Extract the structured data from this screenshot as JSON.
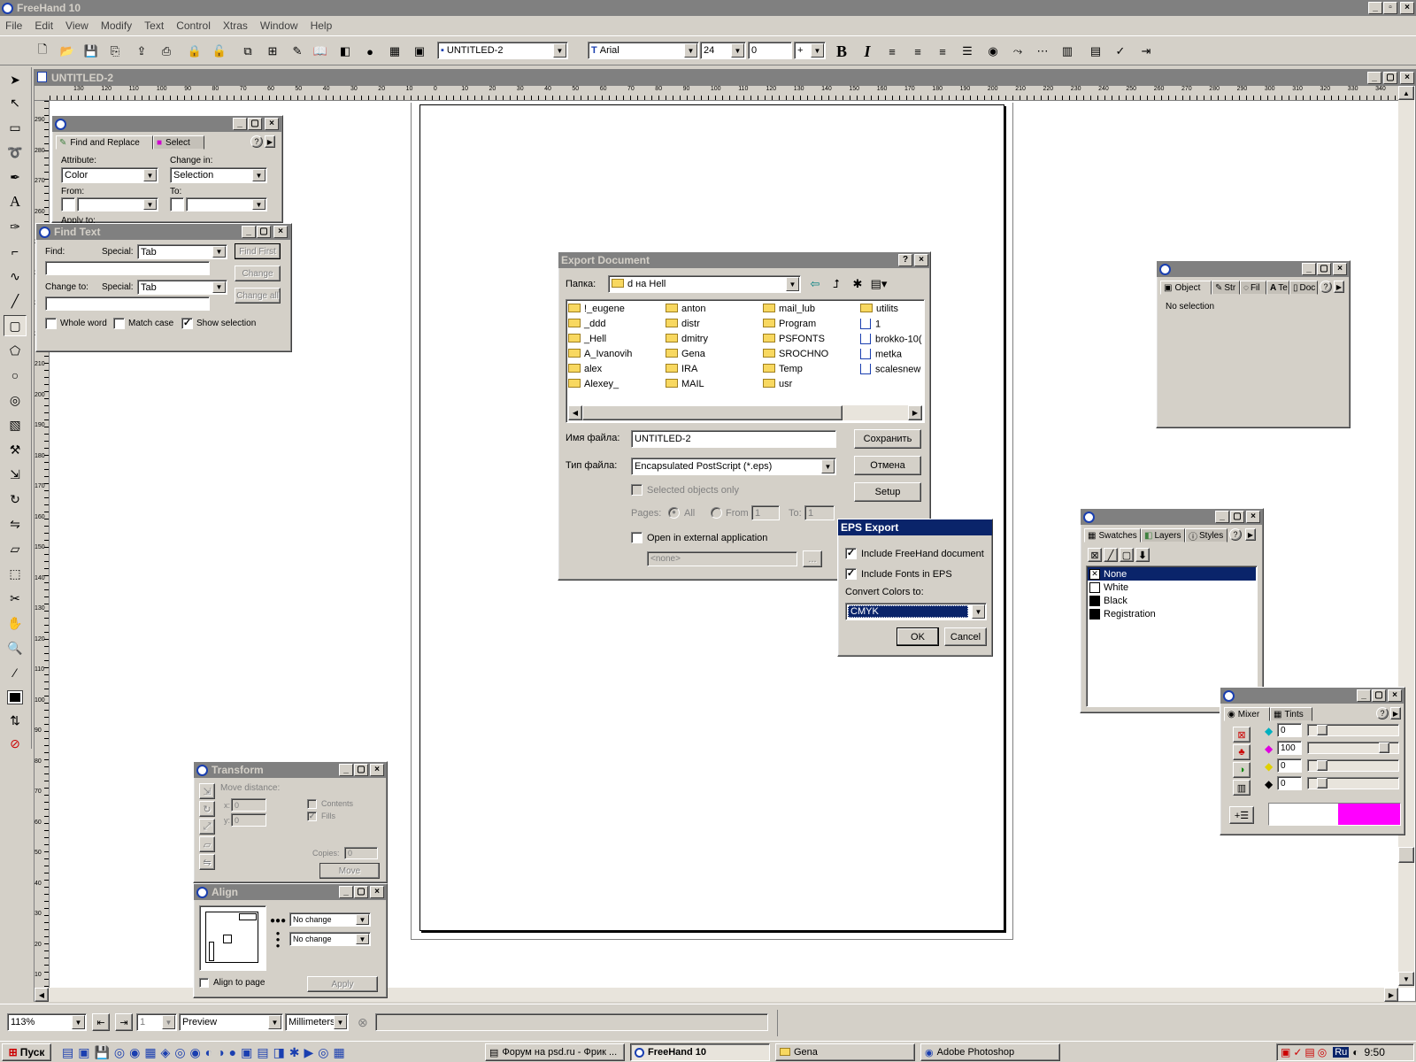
{
  "app": {
    "title": "FreeHand 10"
  },
  "menu": [
    "File",
    "Edit",
    "View",
    "Modify",
    "Text",
    "Control",
    "Xtras",
    "Window",
    "Help"
  ],
  "toolbar": {
    "doc_select": "UNTITLED-2",
    "font_select": "Arial",
    "size_select": "24",
    "leading_value": "0",
    "leading_mode": "+",
    "bold_label": "B",
    "italic_label": "I"
  },
  "document": {
    "title": "UNTITLED-2"
  },
  "ruler_h": [
    "130",
    "120",
    "110",
    "100",
    "90",
    "80",
    "70",
    "60",
    "50",
    "40",
    "30",
    "20",
    "10",
    "0",
    "10",
    "20",
    "30",
    "40",
    "50",
    "60",
    "70",
    "80",
    "90",
    "100",
    "110",
    "120",
    "130",
    "140",
    "150",
    "160",
    "170",
    "180",
    "190",
    "200",
    "210",
    "220",
    "230",
    "240",
    "250",
    "260",
    "270",
    "280",
    "290",
    "300",
    "310",
    "320",
    "330",
    "340"
  ],
  "ruler_v": [
    "290",
    "280",
    "270",
    "260",
    "250",
    "240",
    "230",
    "220",
    "210",
    "200",
    "190",
    "180",
    "170",
    "160",
    "150",
    "140",
    "130",
    "120",
    "110",
    "100",
    "90",
    "80",
    "70",
    "60",
    "50",
    "40",
    "30",
    "20",
    "10"
  ],
  "find_replace": {
    "tab1": "Find and Replace",
    "tab2": "Select",
    "attribute_label": "Attribute:",
    "attribute_value": "Color",
    "change_in_label": "Change in:",
    "change_in_value": "Selection",
    "from_label": "From:",
    "to_label": "To:",
    "apply_label": "Apply to:"
  },
  "find_text": {
    "title": "Find Text",
    "find_label": "Find:",
    "special_label": "Special:",
    "special_value": "Tab",
    "change_to_label": "Change to:",
    "special2_value": "Tab",
    "find_first": "Find First",
    "change": "Change",
    "change_all": "Change all",
    "whole_word": "Whole word",
    "match_case": "Match case",
    "show_selection": "Show selection"
  },
  "export_dialog": {
    "title": "Export Document",
    "folder_label": "Папка:",
    "folder_value": "d на Hell",
    "files": [
      [
        "!_eugene",
        "anton",
        "mail_lub",
        "utilits"
      ],
      [
        "_ddd",
        "distr",
        "Program",
        "1"
      ],
      [
        "_Hell",
        "dmitry",
        "PSFONTS",
        "brokko-10("
      ],
      [
        "A_Ivanovih",
        "Gena",
        "SROCHNO",
        "metka"
      ],
      [
        "alex",
        "IRA",
        "Temp",
        "scalesnew"
      ],
      [
        "Alexey_",
        "MAIL",
        "usr",
        ""
      ]
    ],
    "filename_label": "Имя файла:",
    "filename_value": "UNTITLED-2",
    "filetype_label": "Тип файла:",
    "filetype_value": "Encapsulated PostScript (*.eps)",
    "save_button": "Сохранить",
    "cancel_button": "Отмена",
    "setup_button": "Setup",
    "selected_only": "Selected objects only",
    "pages_label": "Pages:",
    "all_label": "All",
    "from_label": "From",
    "from_value": "1",
    "to_label": "To:",
    "to_value": "1",
    "open_external": "Open in external application",
    "none_value": "<none>",
    "browse": "..."
  },
  "eps_export": {
    "title": "EPS Export",
    "include_fh": "Include FreeHand document",
    "include_fonts": "Include Fonts in EPS",
    "convert_label": "Convert Colors to:",
    "convert_value": "CMYK",
    "ok": "OK",
    "cancel": "Cancel"
  },
  "object_panel": {
    "tabs": [
      "Object",
      "Str",
      "Fil",
      "Te",
      "Doc"
    ],
    "no_selection": "No selection"
  },
  "swatches": {
    "tabs": [
      "Swatches",
      "Layers",
      "Styles"
    ],
    "items": [
      "None",
      "White",
      "Black",
      "Registration"
    ]
  },
  "mixer": {
    "tabs": [
      "Mixer",
      "Tints"
    ],
    "values": [
      "0",
      "100",
      "0",
      "0"
    ],
    "preview_color": "#ff00ff"
  },
  "transform": {
    "title": "Transform",
    "move_distance": "Move distance:",
    "x_label": "x:",
    "x_value": "0",
    "y_label": "y:",
    "y_value": "0",
    "contents": "Contents",
    "fills": "Fills",
    "copies_label": "Copies:",
    "copies_value": "0",
    "move_button": "Move"
  },
  "align": {
    "title": "Align",
    "h_value": "No change",
    "v_value": "No change",
    "align_to_page": "Align to page",
    "apply": "Apply"
  },
  "status": {
    "zoom": "113%",
    "page": "1",
    "mode": "Preview",
    "units": "Millimeters"
  },
  "taskbar": {
    "start": "Пуск",
    "tasks": [
      "Форум на psd.ru - Фрик ...",
      "FreeHand 10",
      "Gena",
      "Adobe Photoshop"
    ],
    "lang": "Ru",
    "clock": "9:50"
  }
}
